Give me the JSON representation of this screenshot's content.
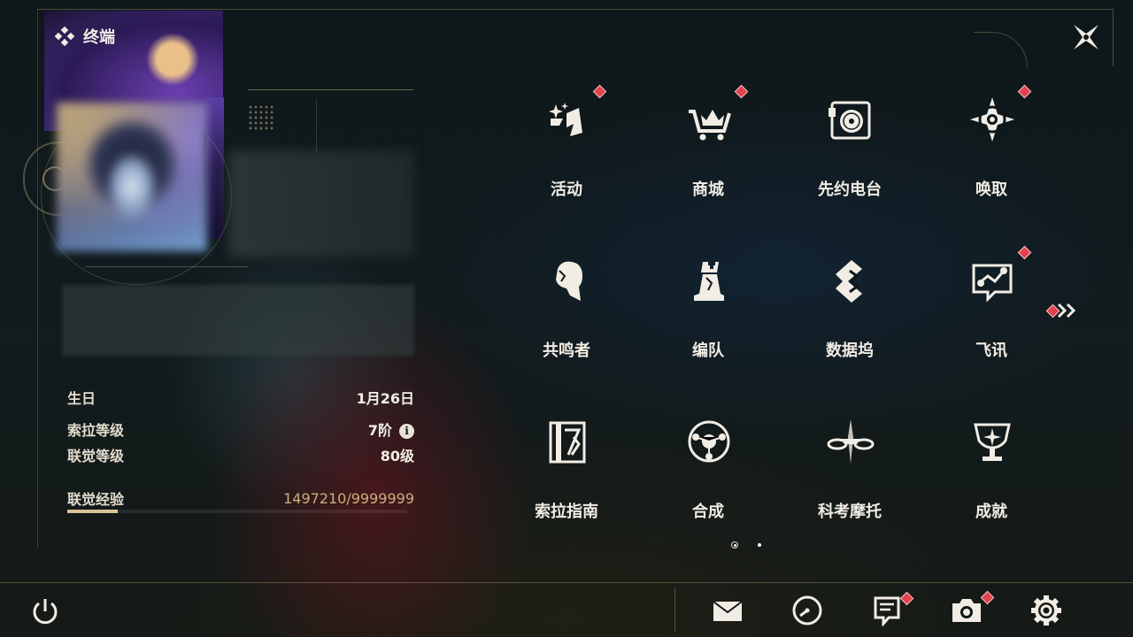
{
  "header": {
    "title": "终端"
  },
  "profile": {
    "rows": [
      {
        "key": "生日",
        "value": "1月26日"
      },
      {
        "key": "索拉等级",
        "value": "7阶"
      },
      {
        "key": "联觉等级",
        "value": "80级"
      }
    ],
    "exp_label": "联觉经验",
    "exp_value": "1497210/9999999",
    "exp_progress": 0.1497
  },
  "menu": {
    "items": [
      {
        "label": "活动",
        "icon": "activity-icon",
        "badge": true
      },
      {
        "label": "商城",
        "icon": "shop-cart-icon",
        "badge": true
      },
      {
        "label": "先约电台",
        "icon": "radio-icon",
        "badge": false
      },
      {
        "label": "唤取",
        "icon": "convene-icon",
        "badge": true
      },
      {
        "label": "共鸣者",
        "icon": "resonator-icon",
        "badge": false
      },
      {
        "label": "编队",
        "icon": "chess-team-icon",
        "badge": false
      },
      {
        "label": "数据坞",
        "icon": "data-bank-icon",
        "badge": false
      },
      {
        "label": "飞讯",
        "icon": "message-icon",
        "badge": true
      },
      {
        "label": "索拉指南",
        "icon": "guidebook-icon",
        "badge": false
      },
      {
        "label": "合成",
        "icon": "synthesis-icon",
        "badge": false
      },
      {
        "label": "科考摩托",
        "icon": "motorcycle-icon",
        "badge": false
      },
      {
        "label": "成就",
        "icon": "trophy-icon",
        "badge": false
      }
    ],
    "pages": 2,
    "current_page": 1
  },
  "toolbar": {
    "items": [
      {
        "icon": "mail-icon",
        "badge": false
      },
      {
        "icon": "clock-icon",
        "badge": false
      },
      {
        "icon": "notice-icon",
        "badge": true
      },
      {
        "icon": "camera-icon",
        "badge": true
      },
      {
        "icon": "settings-icon",
        "badge": false
      }
    ]
  },
  "colors": {
    "accent": "#c9b07a",
    "badge": "#e0424e",
    "text": "#f1ede4"
  }
}
